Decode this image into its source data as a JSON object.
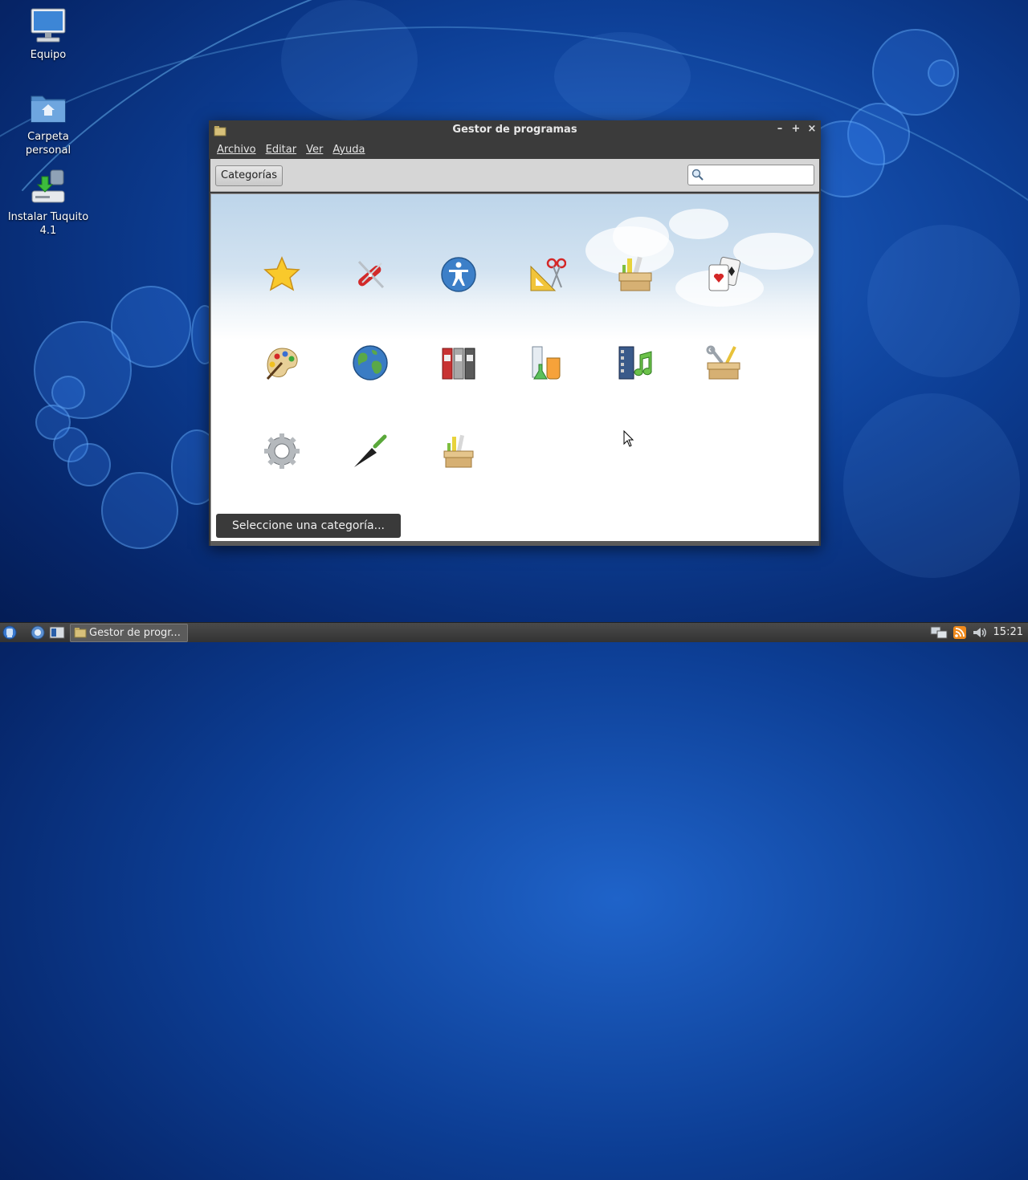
{
  "desktop": {
    "icons": [
      {
        "label": "Equipo",
        "icon": "computer-icon"
      },
      {
        "label": "Carpeta personal",
        "icon": "home-folder-icon"
      },
      {
        "label": "Instalar Tuquito 4.1",
        "icon": "installer-icon"
      }
    ]
  },
  "window": {
    "title": "Gestor de programas",
    "buttons": {
      "minimize": "–",
      "maximize": "+",
      "close": "×"
    },
    "menu": [
      {
        "label": "Archivo"
      },
      {
        "label": "Editar"
      },
      {
        "label": "Ver"
      },
      {
        "label": "Ayuda"
      }
    ],
    "toolbar": {
      "categories_label": "Categorías",
      "search_placeholder": "",
      "search_value": ""
    },
    "categories": [
      {
        "icon": "star-icon"
      },
      {
        "icon": "swiss-knife-icon"
      },
      {
        "icon": "accessibility-icon"
      },
      {
        "icon": "ruler-scissors-icon"
      },
      {
        "icon": "toolbox-icon"
      },
      {
        "icon": "playing-cards-icon"
      },
      {
        "icon": "paint-palette-icon"
      },
      {
        "icon": "globe-icon"
      },
      {
        "icon": "binders-icon"
      },
      {
        "icon": "science-flasks-icon"
      },
      {
        "icon": "multimedia-icon"
      },
      {
        "icon": "system-tools-icon"
      },
      {
        "icon": "gear-icon"
      },
      {
        "icon": "trowel-icon"
      },
      {
        "icon": "toolbox-small-icon"
      }
    ],
    "status_tip": "Seleccione una categoría..."
  },
  "taskbar": {
    "task_label": "Gestor de progr...",
    "clock": "15:21"
  },
  "colors": {
    "desktop_bg": "#0d3f96",
    "window_frame": "#3b3b3b",
    "toolbar_bg": "#d6d6d6",
    "taskbar_bg": "#3b3b3b"
  }
}
